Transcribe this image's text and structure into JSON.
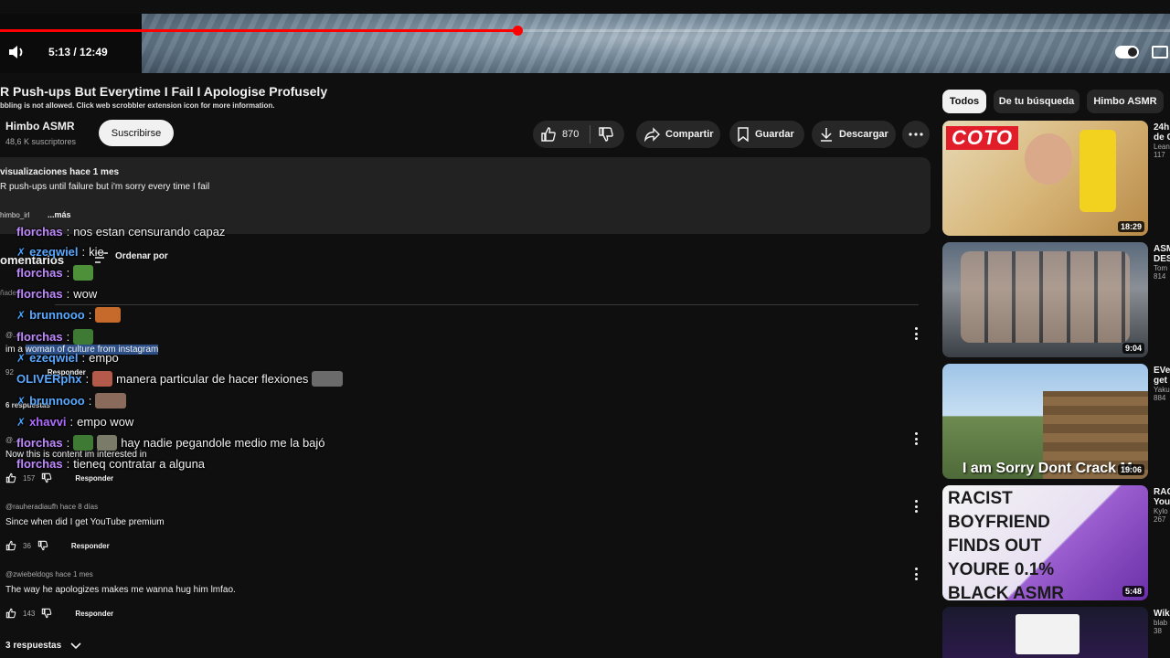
{
  "player": {
    "time": "5:13 / 12:49",
    "progress": 0.4418
  },
  "video": {
    "title": "R Push-ups But Everytime I Fail I Apologise Profusely",
    "scrobble_notice": "bbling is not allowed. Click web scrobbler extension icon for more information.",
    "channel_name": "Himbo ASMR",
    "subscribers": "48,6 K suscriptores",
    "subscribe_label": "Suscribirse",
    "likes": "870",
    "share_label": "Compartir",
    "save_label": "Guardar",
    "download_label": "Descargar"
  },
  "description": {
    "views_line": "visualizaciones  hace 1 mes",
    "text": "R push-ups until failure but i'm sorry every time I fail",
    "tag": "himbo_irl",
    "more_label": "...más"
  },
  "comments_header": {
    "title": "omentarios",
    "sort_label": "Ordenar por",
    "add_placeholder": "ñade"
  },
  "comments": [
    {
      "author": "@...",
      "text": "im a woman of culture from instagram",
      "text_pre": "im a ",
      "text_sel": "woman of culture from instagram",
      "likes": "92",
      "reply_label": "Responder",
      "replies": "6 respuestas"
    },
    {
      "author": "@...",
      "text": "Now this is content im interested in",
      "likes": "157",
      "reply_label": "Responder"
    },
    {
      "author": "@rauheradiaufh",
      "time": "hace 8 días",
      "text": "Since when did I get YouTube premium",
      "likes": "36",
      "reply_label": "Responder"
    },
    {
      "author": "@zwiebeldogs",
      "time": "hace 1 mes",
      "text": "The way he apologizes makes me wanna hug him lmfao.",
      "likes": "143",
      "reply_label": "Responder",
      "replies": "3 respuestas"
    }
  ],
  "chat": [
    {
      "user": "florchas",
      "color": "#c08aff",
      "text": "nos estan censurando capaz"
    },
    {
      "user": "ezeqwiel",
      "color": "#5aa9ff",
      "text": "kie"
    },
    {
      "user": "florchas",
      "color": "#c08aff",
      "text": ""
    },
    {
      "user": "florchas",
      "color": "#c08aff",
      "text": "wow"
    },
    {
      "user": "brunnooo",
      "color": "#5aa9ff",
      "text": ""
    },
    {
      "user": "florchas",
      "color": "#c08aff",
      "text": ""
    },
    {
      "user": "ezeqwiel",
      "color": "#5aa9ff",
      "text": "empo"
    },
    {
      "user": "OLIVERphx",
      "color": "#5aa9ff",
      "text": "manera particular de hacer flexiones"
    },
    {
      "user": "brunnooo",
      "color": "#5aa9ff",
      "text": ""
    },
    {
      "user": "xhavvi",
      "color": "#b06cff",
      "text": "empo wow"
    },
    {
      "user": "florchas",
      "color": "#c08aff",
      "text": "hay nadie pegandole medio me la bajó"
    },
    {
      "user": "florchas",
      "color": "#c08aff",
      "text": "tieneq contratar a alguna"
    }
  ],
  "chips": [
    "Todos",
    "De tu búsqueda",
    "Himbo ASMR"
  ],
  "related": [
    {
      "thumb_text": "COTO",
      "duration": "18:29",
      "title": "24h",
      "title2": "de C",
      "channel": "Lean",
      "views": "117"
    },
    {
      "thumb_text": "",
      "duration": "9:04",
      "title": "ASM",
      "title2": "DES",
      "channel": "Tom",
      "views": "814"
    },
    {
      "thumb_text": "I am Sorry Dont Crack M",
      "duration": "19:06",
      "title": "EVe",
      "title2": "get",
      "channel": "Yaku",
      "views": "884"
    },
    {
      "thumb_text": "RACIST BOYFRIEND FINDS OUT YOURE 0.1% BLACK ASMR",
      "duration": "5:48",
      "title": "RAC",
      "title2": "You",
      "channel": "Kylo",
      "views": "267"
    },
    {
      "thumb_text": "",
      "duration": "",
      "title": "Wik",
      "title2": "",
      "channel": "blab",
      "views": "38"
    }
  ]
}
